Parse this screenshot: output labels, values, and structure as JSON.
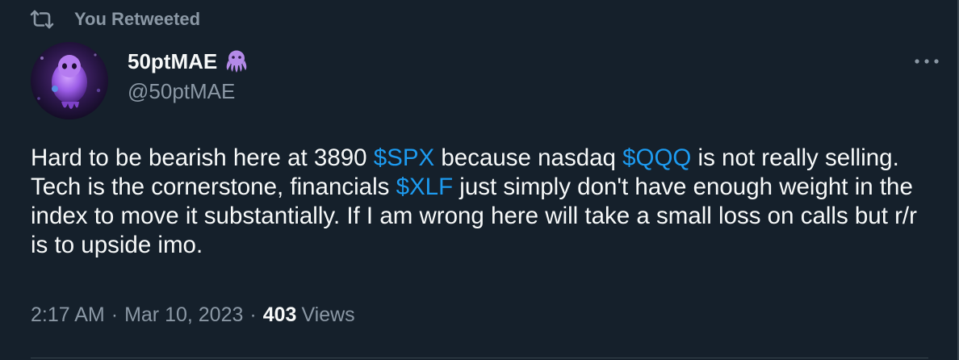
{
  "social_context": {
    "icon": "retweet-icon",
    "text": "You Retweeted"
  },
  "author": {
    "display_name": "50ptMAE",
    "name_emoji": "octopus-emoji",
    "handle": "@50ptMAE",
    "avatar": "avatar"
  },
  "more_menu": {
    "icon": "more-dots-icon"
  },
  "tweet": {
    "segments": [
      {
        "text": "Hard to be bearish here at 3890 ",
        "cashtag": false
      },
      {
        "text": "$SPX",
        "cashtag": true
      },
      {
        "text": " because nasdaq ",
        "cashtag": false
      },
      {
        "text": "$QQQ",
        "cashtag": true
      },
      {
        "text": " is not really selling. Tech is the cornerstone, financials ",
        "cashtag": false
      },
      {
        "text": "$XLF",
        "cashtag": true
      },
      {
        "text": " just simply don't have enough weight in the index to move it substantially. If I am wrong here will take a small loss on calls but r/r is to upside imo.",
        "cashtag": false
      }
    ]
  },
  "meta": {
    "time": "2:17 AM",
    "separator": "·",
    "date": "Mar 10, 2023",
    "views_count": "403",
    "views_label": "Views"
  },
  "colors": {
    "background": "#15202b",
    "primary_text": "#f7f9f9",
    "secondary_text": "#8b98a5",
    "link": "#1d9bf0",
    "border": "#38444d",
    "emoji_purple": "#b48ae8"
  }
}
